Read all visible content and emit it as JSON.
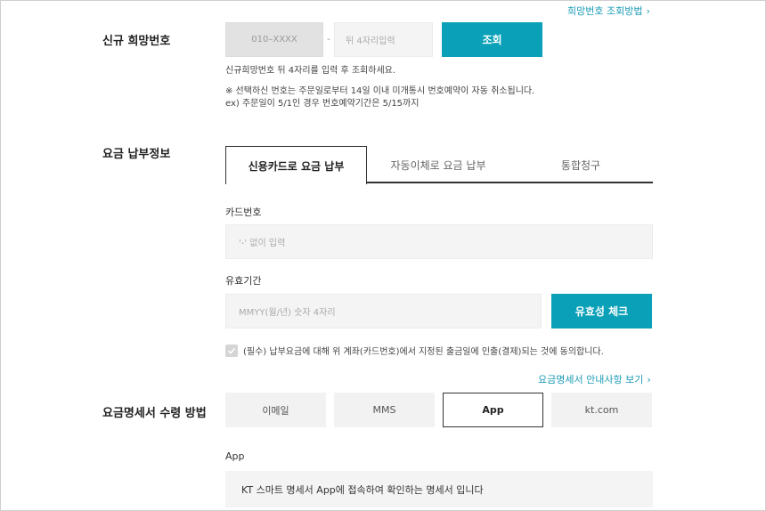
{
  "links": {
    "number_lookup": "희망번호 조회방법",
    "statement_info": "요금명세서 안내사항 보기",
    "chevron": "›"
  },
  "new_number": {
    "label": "신규 희망번호",
    "prefix_placeholder": "010–XXXX",
    "dash": "-",
    "digits_placeholder": "뒤 4자리입력",
    "search_button": "조회",
    "hint": "신규희망번호 뒤 4자리를 입력 후 조회하세요.",
    "notice_line1": "※ 선택하신 번호는 주문일로부터 14일 이내 미개통시 번호예약이 자동 취소됩니다.",
    "notice_line2": "ex) 주문일이 5/1인 경우 번호예약기간은 5/15까지"
  },
  "payment": {
    "label": "요금 납부정보",
    "tabs": [
      {
        "label": "신용카드로 요금 납부",
        "active": true
      },
      {
        "label": "자동이체로 요금 납부",
        "active": false
      },
      {
        "label": "통합청구",
        "active": false
      }
    ],
    "card_number_label": "카드번호",
    "card_number_placeholder": "'-' 없이 입력",
    "expiry_label": "유효기간",
    "expiry_placeholder": "MMYY(월/년) 숫자 4자리",
    "validity_button": "유효성 체크",
    "consent_text": "(필수) 납부요금에 대해 위 계좌(카드번호)에서 지정된 출금일에 인출(결제)되는 것에 동의합니다.",
    "consent_checked": true
  },
  "statement": {
    "label": "요금명세서 수령 방법",
    "options": [
      {
        "label": "이메일",
        "active": false
      },
      {
        "label": "MMS",
        "active": false
      },
      {
        "label": "App",
        "active": true
      },
      {
        "label": "kt.com",
        "active": false
      }
    ],
    "selected_label": "App",
    "description": "KT 스마트 명세서 App에 접속하여 확인하는 명세서 입니다"
  },
  "colors": {
    "accent": "#0aa1b8",
    "link": "#1a9bb5",
    "field_bg": "#f4f4f4"
  }
}
